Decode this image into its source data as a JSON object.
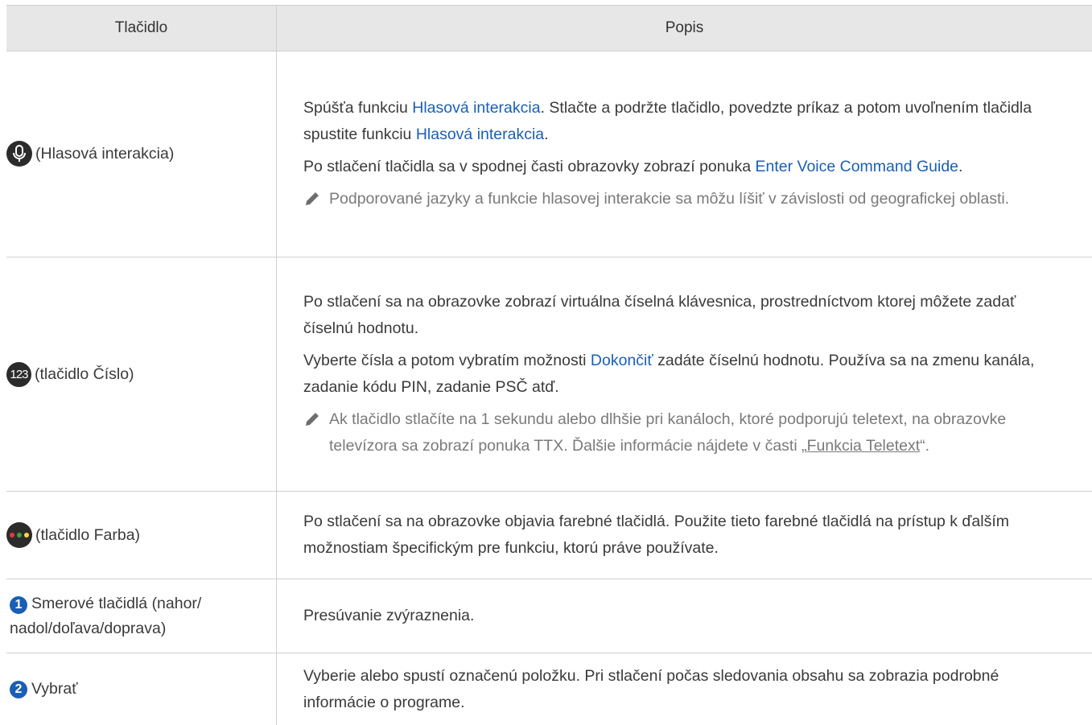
{
  "header": {
    "col_button": "Tlačidlo",
    "col_desc": "Popis"
  },
  "rows": [
    {
      "button_label": "(Hlasová interakcia)",
      "icon": "microphone-icon",
      "desc": {
        "p1_a": "Spúšťa funkciu ",
        "p1_link1": "Hlasová interakcia",
        "p1_b": ". Stlačte a podržte tlačidlo, povedzte príkaz a potom uvoľnením tlačidla spustite funkciu ",
        "p1_link2": "Hlasová interakcia",
        "p1_c": ".",
        "p2_a": "Po stlačení tlačidla sa v spodnej časti obrazovky zobrazí ponuka ",
        "p2_link": "Enter Voice Command Guide",
        "p2_b": ".",
        "note": "Podporované jazyky a funkcie hlasovej interakcie sa môžu líšiť v závislosti od geografickej oblasti."
      }
    },
    {
      "button_label": "(tlačidlo Číslo)",
      "icon": "number-123-icon",
      "icon_text": "123",
      "desc": {
        "p1": "Po stlačení sa na obrazovke zobrazí virtuálna číselná klávesnica, prostredníctvom ktorej môžete zadať číselnú hodnotu.",
        "p2_a": "Vyberte čísla a potom vybratím možnosti ",
        "p2_link": "Dokončiť",
        "p2_b": " zadáte číselnú hodnotu. Používa sa na zmenu kanála, zadanie kódu PIN, zadanie PSČ atď.",
        "note_a": "Ak tlačidlo stlačíte na 1 sekundu alebo dlhšie pri kanáloch, ktoré podporujú teletext, na obrazovke televízora sa zobrazí ponuka TTX. Ďalšie informácie nájdete v časti „",
        "note_link": "Funkcia Teletext",
        "note_b": "“."
      }
    },
    {
      "button_label": "(tlačidlo Farba)",
      "icon": "color-dots-icon",
      "colors": [
        "#e53935",
        "#43a047",
        "#fdd835"
      ],
      "desc": {
        "p1": "Po stlačení sa na obrazovke objavia farebné tlačidlá. Použite tieto farebné tlačidlá na prístup k ďalším možnostiam špecifickým pre funkciu, ktorú práve používate."
      }
    },
    {
      "badge": "1",
      "button_label": "Smerové tlačidlá (nahor/ nadol/doľava/doprava)",
      "desc": {
        "p1": "Presúvanie zvýraznenia."
      }
    },
    {
      "badge": "2",
      "button_label": "Vybrať",
      "desc": {
        "p1": "Vyberie alebo spustí označenú položku. Pri stlačení počas sledovania obsahu sa zobrazia podrobné informácie o programe."
      }
    }
  ],
  "colors": {
    "link": "#1a5fb4",
    "badge": "#1a5fb4",
    "header_bg": "#e7e7e7"
  }
}
